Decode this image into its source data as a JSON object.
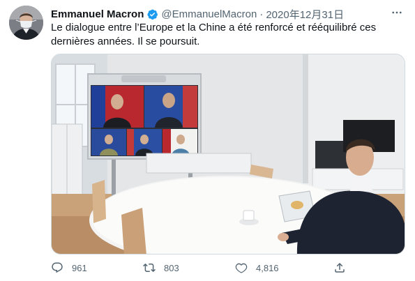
{
  "author": {
    "display_name": "Emmanuel Macron",
    "handle": "@EmmanuelMacron",
    "separator": "·",
    "date": "2020年12月31日",
    "verified": true
  },
  "tweet": {
    "text_line_1": "Le dialogue entre l’Europe et la Chine a été renforcé et rééquilibré ces",
    "text_line_2": "dernières années. Il se poursuit."
  },
  "actions": {
    "reply_count": "961",
    "retweet_count": "803",
    "like_count": "4,816"
  },
  "icons": {
    "reply": "reply-icon",
    "retweet": "retweet-icon",
    "like": "heart-icon",
    "share": "share-icon",
    "more": "more-icon",
    "verified": "verified-badge-icon"
  },
  "colors": {
    "verified_blue": "#1d9bf0",
    "secondary_text": "#536471",
    "primary_text": "#0f1419"
  }
}
